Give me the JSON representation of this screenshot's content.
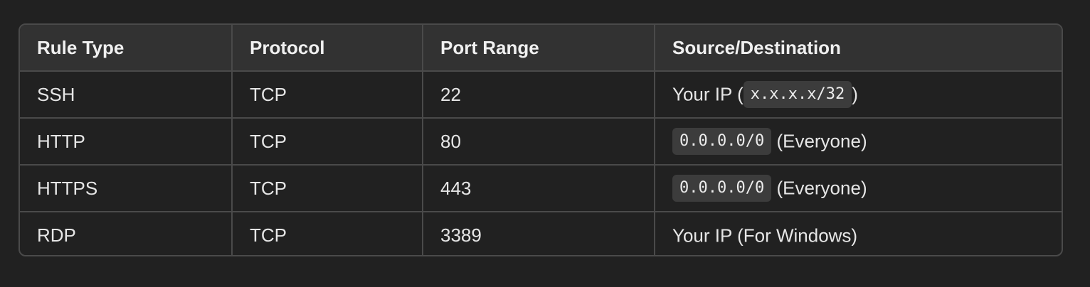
{
  "table": {
    "headers": [
      "Rule Type",
      "Protocol",
      "Port Range",
      "Source/Destination"
    ],
    "rows": [
      {
        "rule_type": "SSH",
        "protocol": "TCP",
        "port_range": "22",
        "source_prefix": "Your IP (",
        "source_code": "x.x.x.x/32",
        "source_suffix": ")"
      },
      {
        "rule_type": "HTTP",
        "protocol": "TCP",
        "port_range": "80",
        "source_prefix": "",
        "source_code": "0.0.0.0/0",
        "source_suffix": " (Everyone)"
      },
      {
        "rule_type": "HTTPS",
        "protocol": "TCP",
        "port_range": "443",
        "source_prefix": "",
        "source_code": "0.0.0.0/0",
        "source_suffix": " (Everyone)"
      },
      {
        "rule_type": "RDP",
        "protocol": "TCP",
        "port_range": "3389",
        "source_prefix": "Your IP (For Windows)",
        "source_code": "",
        "source_suffix": ""
      }
    ]
  }
}
